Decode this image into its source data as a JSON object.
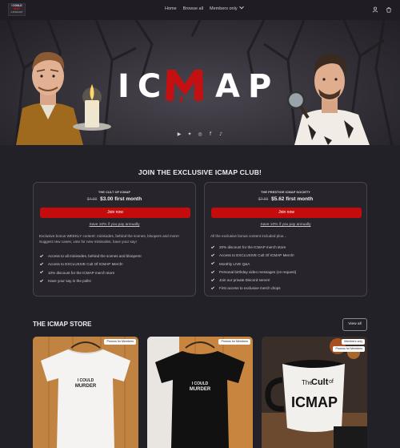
{
  "brand": {
    "logo_line1": "I COULD",
    "logo_line2": "MAP",
    "logo_line3": "A PODCAST"
  },
  "nav": {
    "home": "Home",
    "browse_all": "Browse all",
    "members_only": "Members only"
  },
  "hero": {
    "title_left": "IC",
    "title_mid": "MAP",
    "socials": [
      "youtube-icon",
      "twitter-icon",
      "instagram-icon",
      "facebook-icon",
      "tiktok-icon"
    ]
  },
  "club": {
    "title": "JOIN THE EXCLUSIVE ICMAP CLUB!",
    "tiers": [
      {
        "name": "THE CULT OF ICMAP",
        "old_price": "$4.99",
        "price": "$3.00 first month",
        "join": "Join now",
        "save": "Save 10% if you pay annually",
        "description": "Exclusive bonus WEEKLY content: minisodes, behind the scenes, bloopers and more! Suggest new cases, vote for new minisodes, have your say!",
        "features": [
          "Access to all minisodes, behind the scenes and bloopers!",
          "Access to EXCLUSIVE Cult Of ICMAP Merch!",
          "10% discount for the ICMAP merch store",
          "Have your say in the polls!"
        ]
      },
      {
        "name": "THE PRESTIGE ICMAP SOCIETY",
        "old_price": "$7.99",
        "price": "$5.62 first month",
        "join": "Join now",
        "save": "Save 10% if you pay annually",
        "description": "All the exclusive bonus content included plus...",
        "features": [
          "20% discount for the ICMAP merch store",
          "Access to EXCLUSIVE Cult Of ICMAP Merch!",
          "Monthly LIVE Q&A",
          "Personal birthday video messages (on request)",
          "Join our private Discord server!",
          "First access to exclusive merch drops"
        ]
      }
    ]
  },
  "store": {
    "title": "THE ICMAP STORE",
    "view_all": "View all",
    "products": [
      {
        "badges": [
          "Promos for Members"
        ],
        "print_line1": "I COULD",
        "print_line2": "MURDER"
      },
      {
        "badges": [
          "Promos for Members"
        ],
        "print_line1": "I COULD",
        "print_line2": "MURDER"
      },
      {
        "badges": [
          "Members only",
          "Promos for Members"
        ],
        "print_line1": "The",
        "print_line2": "Cult",
        "print_line3": "of",
        "print_line4": "ICMAP"
      }
    ]
  },
  "colors": {
    "background": "#232128",
    "accent_red": "#c40c0c",
    "card_border": "#47434d"
  }
}
